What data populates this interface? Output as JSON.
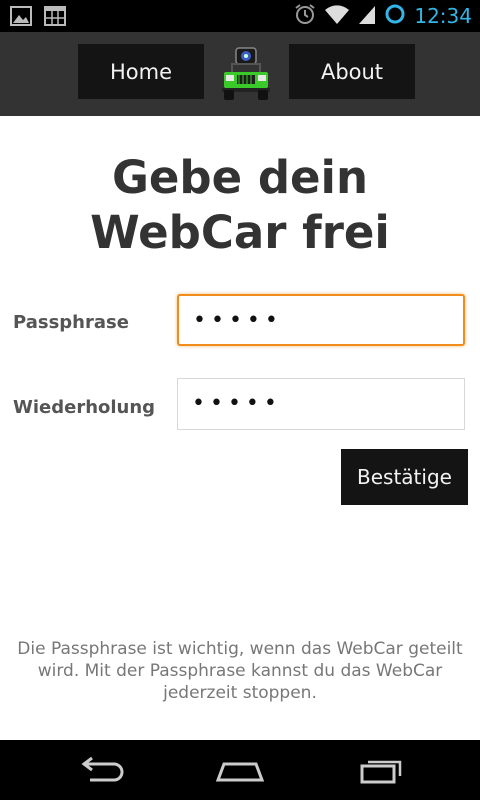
{
  "status_bar": {
    "time": "12:34",
    "left_icons": [
      "gallery-icon",
      "calendar-grid-icon"
    ],
    "right_icons": [
      "alarm-icon",
      "wifi-icon",
      "signal-icon",
      "battery-ring-icon"
    ],
    "time_color": "#33b5e5"
  },
  "top_nav": {
    "home_label": "Home",
    "about_label": "About",
    "logo_icon": "jeep-webcar-logo"
  },
  "main": {
    "title_line1": "Gebe dein",
    "title_line2": "WebCar frei",
    "passphrase_label": "Passphrase",
    "passphrase_value": "•••••",
    "repeat_label": "Wiederholung",
    "repeat_value": "•••••",
    "confirm_label": "Bestätige",
    "info_line1": "Die Passphrase ist wichtig, wenn das WebCar geteilt",
    "info_line2": "wird. Mit der Passphrase kannst du das WebCar",
    "info_line3": "jederzeit stoppen."
  },
  "nav_bar": {
    "icons": [
      "back-icon",
      "home-icon",
      "recent-apps-icon"
    ]
  },
  "colors": {
    "focus_border": "#f08d1d",
    "nav_bg": "#333333",
    "button_bg": "#141414"
  }
}
